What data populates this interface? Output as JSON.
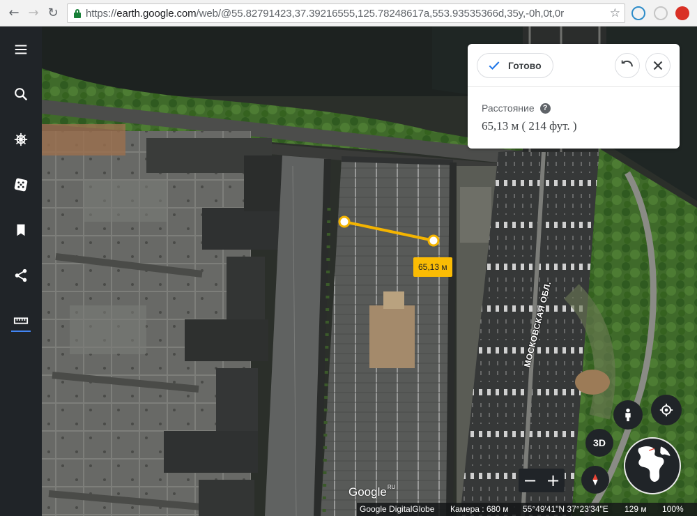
{
  "browser": {
    "url_scheme": "https://",
    "url_host": "earth.google.com",
    "url_path": "/web/@55.82791423,37.39216555,125.78248617a,553.93535366d,35y,-0h,0t,0r",
    "icons": [
      "back-arrow-icon",
      "forward-arrow-icon",
      "reload-icon",
      "lock-icon",
      "star-icon"
    ]
  },
  "sidebar": {
    "items": [
      {
        "name": "menu",
        "icon": "hamburger-icon"
      },
      {
        "name": "search",
        "icon": "search-icon"
      },
      {
        "name": "voyager",
        "icon": "ships-wheel-icon"
      },
      {
        "name": "feeling-lucky",
        "icon": "dice-icon"
      },
      {
        "name": "projects",
        "icon": "bookmark-icon"
      },
      {
        "name": "share",
        "icon": "share-icon"
      },
      {
        "name": "measure",
        "icon": "ruler-icon",
        "active": true
      }
    ]
  },
  "measure_panel": {
    "done_label": "Готово",
    "distance_label": "Расстояние",
    "distance_value": "65,13 м ( 214 фут. )",
    "help": "?"
  },
  "map": {
    "measure_tag": "65,13 м",
    "road_label": "МОСКОВСКАЯ ОБЛ.",
    "controls": {
      "three_d": "3D",
      "zoom_out": "−",
      "zoom_in": "+"
    },
    "logo": "Google",
    "logo_region": "RU"
  },
  "status": {
    "attribution": "Google DigitalGlobe",
    "camera": "Камера :  680 м",
    "coords": "55°49'41\"N 37°23'34\"E",
    "altitude": "129 м",
    "loaded": "100%"
  },
  "colors": {
    "measure_line": "#f4b400",
    "measure_tag": "#fbbc04",
    "accent": "#4285f4",
    "sidebar": "#202428"
  }
}
